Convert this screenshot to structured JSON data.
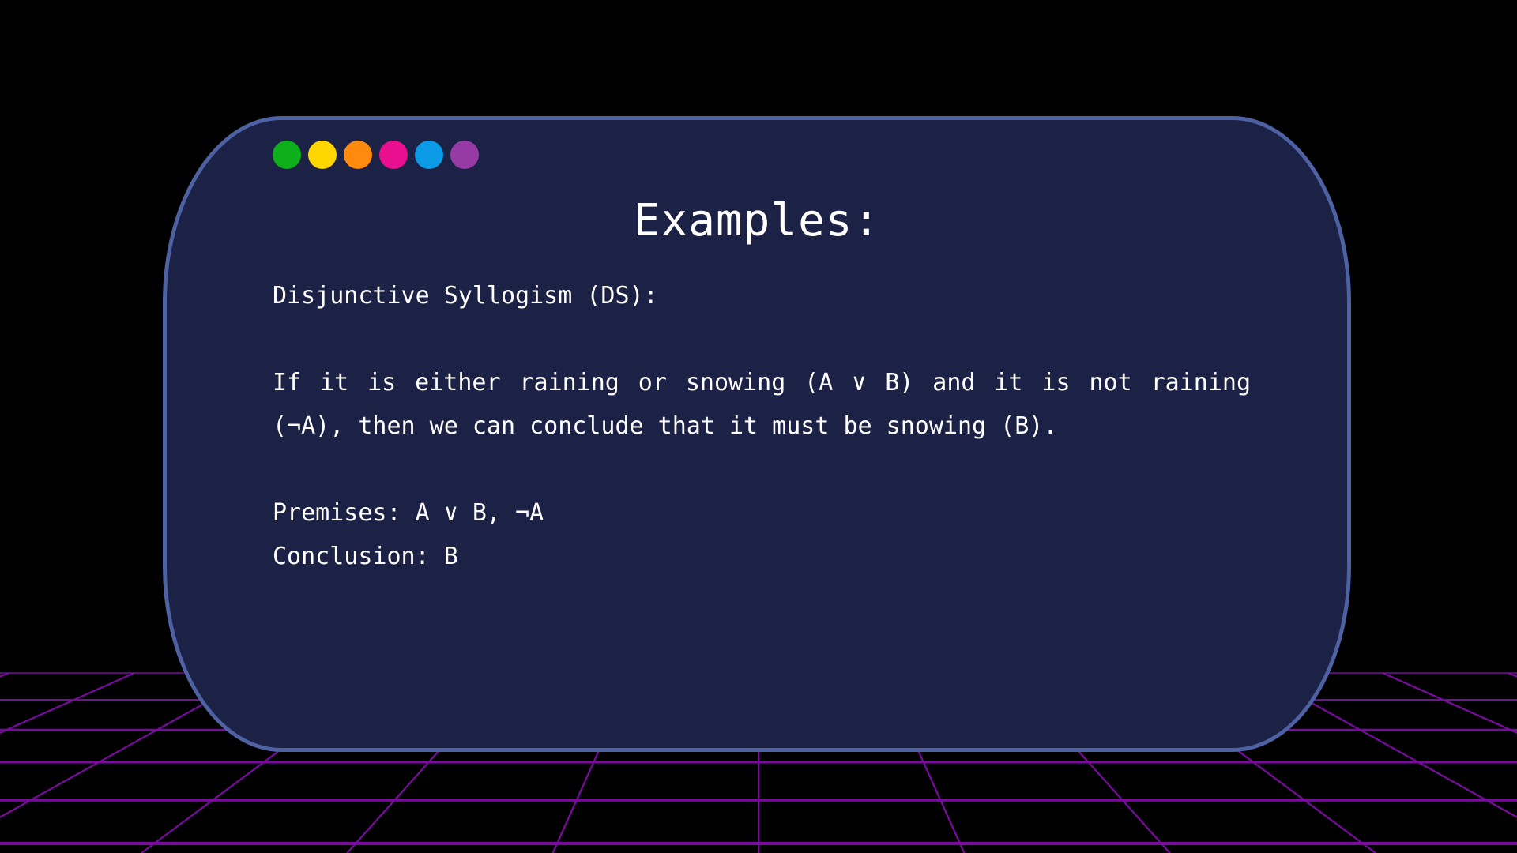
{
  "colors": {
    "background": "#000000",
    "card_fill": "#1c2146",
    "card_border": "#4d61a3",
    "grid_line": "#7a0aa0",
    "text": "#ffffff"
  },
  "window_dots": [
    {
      "name": "green-dot",
      "color": "#0db01a"
    },
    {
      "name": "yellow-dot",
      "color": "#ffd500"
    },
    {
      "name": "orange-dot",
      "color": "#ff8a0d"
    },
    {
      "name": "pink-dot",
      "color": "#ea0f8f"
    },
    {
      "name": "blue-dot",
      "color": "#0a9ae6"
    },
    {
      "name": "purple-dot",
      "color": "#983aa6"
    }
  ],
  "slide": {
    "title": "Examples:",
    "subtitle": "Disjunctive Syllogism (DS):",
    "paragraph": "If it is either raining or snowing (A ∨ B) and it is not raining (¬A), then we can conclude that it must be snowing (B).",
    "premises": "Premises: A ∨ B, ¬A",
    "conclusion": "Conclusion: B"
  }
}
